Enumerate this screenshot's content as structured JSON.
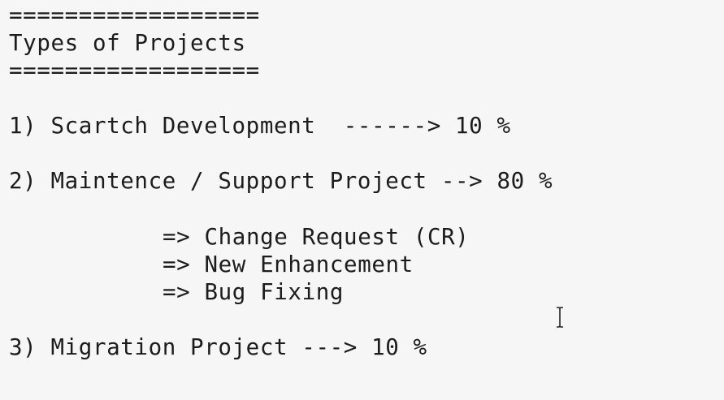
{
  "document": {
    "rule_top": "==================",
    "title": "Types of Projects",
    "rule_bottom": "==================",
    "item_1": "1) Scartch Development  ------> 10 %",
    "item_2": "2) Maintence / Support Project --> 80 %",
    "sub_items": [
      "=> Change Request (CR)",
      "=> New Enhancement",
      "=> Bug Fixing"
    ],
    "item_3": "3) Migration Project ---> 10 %"
  },
  "cursor_icon": "text-cursor-icon"
}
